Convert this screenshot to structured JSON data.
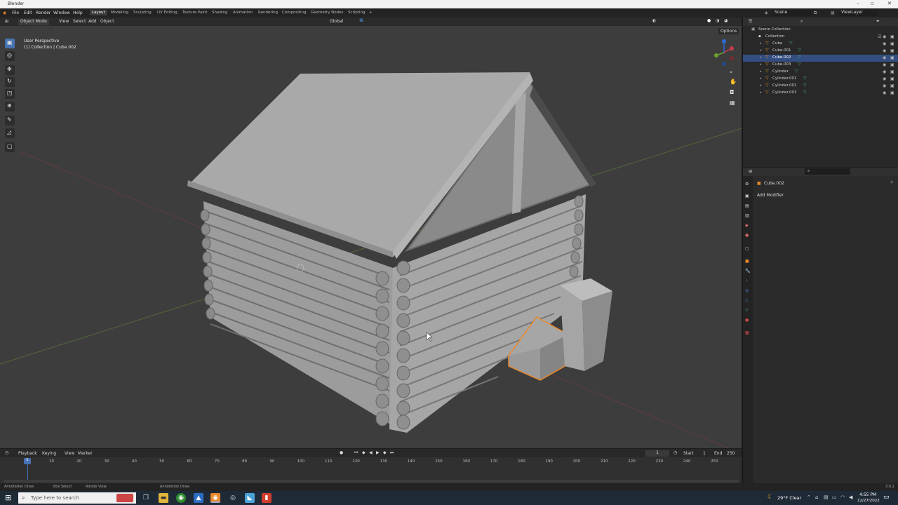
{
  "window": {
    "title": "Blender"
  },
  "menus": [
    "File",
    "Edit",
    "Render",
    "Window",
    "Help"
  ],
  "workspaces": [
    "Layout",
    "Modeling",
    "Sculpting",
    "UV Editing",
    "Texture Paint",
    "Shading",
    "Animation",
    "Rendering",
    "Compositing",
    "Geometry Nodes",
    "Scripting"
  ],
  "active_workspace": "Layout",
  "scene": {
    "name": "Scene",
    "view_layer": "ViewLayer"
  },
  "viewport": {
    "mode": "Object Mode",
    "menus": [
      "View",
      "Select",
      "Add",
      "Object"
    ],
    "orientation": "Global",
    "options_label": "Options",
    "overlay_title": "User Perspective",
    "overlay_sub": "(1) Collection | Cube.002"
  },
  "outliner": {
    "root": "Scene Collection",
    "collection": "Collection",
    "items": [
      {
        "name": "Cube",
        "selected": false
      },
      {
        "name": "Cube.001",
        "selected": false
      },
      {
        "name": "Cube.002",
        "selected": true
      },
      {
        "name": "Cube.003",
        "selected": false
      },
      {
        "name": "Cylinder",
        "selected": false
      },
      {
        "name": "Cylinder.001",
        "selected": false
      },
      {
        "name": "Cylinder.002",
        "selected": false
      },
      {
        "name": "Cylinder.003",
        "selected": false
      }
    ]
  },
  "properties": {
    "object": "Cube.002",
    "add_modifier": "Add Modifier"
  },
  "timeline": {
    "menus": [
      "Playback",
      "Keying",
      "View",
      "Marker"
    ],
    "current_frame": "1",
    "start_label": "Start",
    "start": "1",
    "end_label": "End",
    "end": "250",
    "ticks": [
      "10",
      "20",
      "30",
      "40",
      "50",
      "60",
      "70",
      "80",
      "90",
      "100",
      "110",
      "120",
      "130",
      "140",
      "150",
      "160",
      "170",
      "180",
      "190",
      "200",
      "210",
      "220",
      "230",
      "240",
      "250"
    ],
    "cursor": "1"
  },
  "status": {
    "left1": "Annotation Draw",
    "left2": "Box Select",
    "left3": "Rotate View",
    "mid": "Annotation Draw",
    "version": "3.0.1"
  },
  "taskbar": {
    "search": "Type here to search",
    "weather": "29°F  Clear",
    "time": "4:55 PM",
    "date": "12/27/2022"
  },
  "colors": {
    "selected_outline": "#e8892c",
    "accent": "#4772b3"
  }
}
